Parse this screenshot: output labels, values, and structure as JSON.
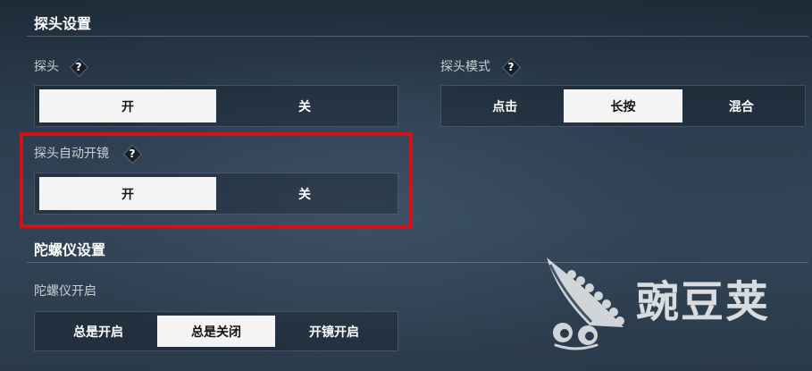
{
  "help_glyph": "?",
  "probe_settings": {
    "title": "探头设置",
    "probe": {
      "label": "探头",
      "options": [
        {
          "label": "开",
          "selected": true
        },
        {
          "label": "关",
          "selected": false
        }
      ]
    },
    "probe_mode": {
      "label": "探头模式",
      "options": [
        {
          "label": "点击",
          "selected": false
        },
        {
          "label": "长按",
          "selected": true
        },
        {
          "label": "混合",
          "selected": false
        }
      ]
    },
    "auto_scope": {
      "label": "探头自动开镜",
      "options": [
        {
          "label": "开",
          "selected": true
        },
        {
          "label": "关",
          "selected": false
        }
      ]
    }
  },
  "gyro_settings": {
    "title": "陀螺仪设置",
    "gyro_enable": {
      "label": "陀螺仪开启",
      "options": [
        {
          "label": "总是开启",
          "selected": false
        },
        {
          "label": "总是关闭",
          "selected": true
        },
        {
          "label": "开镜开启",
          "selected": false
        }
      ]
    }
  },
  "watermark": {
    "text": "豌豆荚",
    "icon": "pea-pod-icon"
  },
  "icons": {
    "help": "help-diamond-icon"
  },
  "colors": {
    "background": "#2c3d4e",
    "text": "#ffffff",
    "selected_bg": "#f4f4f4",
    "selected_text": "#141414",
    "highlight_border": "#d0121b"
  }
}
